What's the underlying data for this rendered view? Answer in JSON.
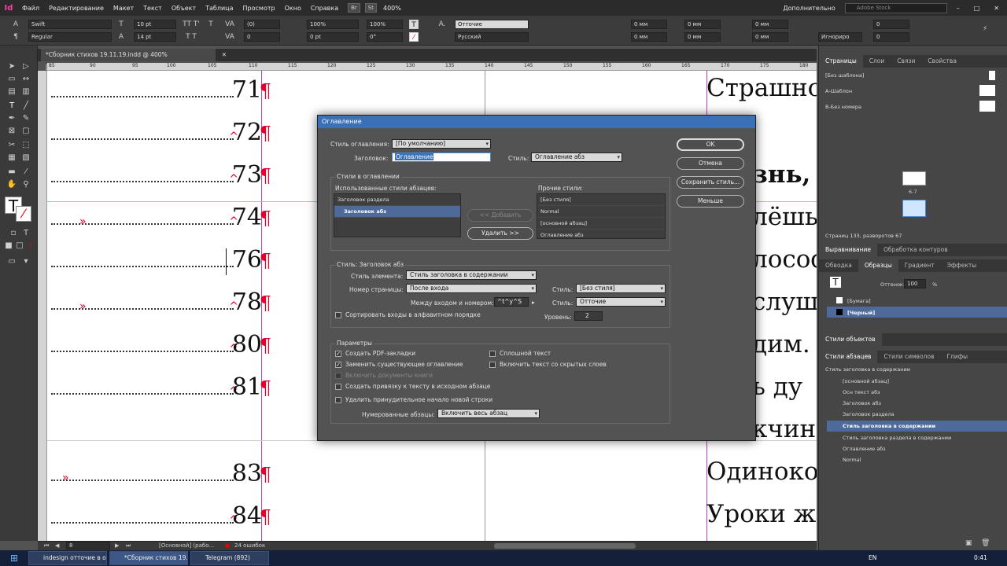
{
  "app": {
    "logo": "Id",
    "menu": [
      "Файл",
      "Редактирование",
      "Макет",
      "Текст",
      "Объект",
      "Таблица",
      "Просмотр",
      "Окно",
      "Справка"
    ],
    "br_badge": "Br",
    "st_badge": "St",
    "zoom": "400%",
    "workspace": "Дополнительно",
    "stock_placeholder": "Adobe Stock"
  },
  "control": {
    "font": "Swift",
    "style": "Regular",
    "size": "10 pt",
    "leading": "14 pt",
    "kerning": "(0)",
    "tracking": "0",
    "scale_v": "100%",
    "scale_h": "100%",
    "baseline": "0 pt",
    "skew": "0°",
    "char_style": "Отточие",
    "language": "Русский",
    "indent_l": "0 мм",
    "indent_r": "0 мм",
    "indent_f": "0 мм",
    "indent_ll": "0 мм",
    "space_b": "0 мм",
    "space_a": "0 мм",
    "cols": "0",
    "cols2": "0",
    "ignore": "Игнориро"
  },
  "document": {
    "tab_title": "*Сборник стихов 19.11.19.indd @ 400% [Преобразован]",
    "ruler_ticks": [
      "85",
      "90",
      "95",
      "100",
      "105",
      "110",
      "115",
      "120",
      "125",
      "130",
      "135",
      "140",
      "145",
      "150",
      "155",
      "160",
      "165",
      "170",
      "175",
      "180"
    ],
    "toc_numbers": [
      "71",
      "72",
      "73",
      "74",
      "76",
      "78",
      "80",
      "81",
      "83",
      "84"
    ],
    "right_text": [
      "Страшно",
      "знь, ",
      "лёшь",
      "лософ",
      "слуш",
      "дим. ",
      "ь ду",
      "кчин",
      "Одиноко",
      "Уроки ж"
    ]
  },
  "status": {
    "page": "8",
    "master": "[Основной] (рабо...",
    "errors": "24 ошибок"
  },
  "panels": {
    "pages_tabs": [
      "Страницы",
      "Слои",
      "Связи",
      "Свойства"
    ],
    "masters": [
      "[Без шаблона]",
      "А-Шаблон",
      "В-Без номера"
    ],
    "spread_label": "6-7",
    "pages_summary": "Страниц 133, разворотов 67",
    "align_tabs": [
      "Выравнивание",
      "Обработка контуров"
    ],
    "swatch_tabs": [
      "Обводка",
      "Образцы",
      "Градиент",
      "Эффекты"
    ],
    "tint_label": "Оттенок:",
    "tint_value": "100",
    "tint_unit": "%",
    "swatches": [
      "[Бумага]",
      "[Черный]"
    ],
    "obj_styles_tab": "Стили объектов",
    "para_tabs": [
      "Стили абзацев",
      "Стили символов",
      "Глифы"
    ],
    "current_style": "Стиль заголовка в содержании",
    "para_styles": [
      "[основной абзац]",
      "Осн текст абз",
      "Заголовок абз",
      "Заголовок раздела",
      "Стиль заголовка в содержании",
      "Стиль заголовка раздела в содержании",
      "Оглавление абз",
      "Normal"
    ]
  },
  "taskbar": {
    "items": [
      "indesign отточие в о...",
      "*Сборник стихов 19....",
      "Telegram (892)"
    ],
    "lang": "EN",
    "time": "0:41"
  },
  "dialog": {
    "title": "Оглавление",
    "toc_style_label": "Стиль оглавления:",
    "toc_style_value": "[По умолчанию]",
    "heading_label": "Заголовок:",
    "heading_value": "Оглавление",
    "style_label": "Стиль:",
    "style_value": "Оглавление абз",
    "styles_group": "Стили в оглавлении",
    "used_label": "Использованные стили абзацев:",
    "used": [
      "Заголовок раздела",
      "Заголовок абз"
    ],
    "add_btn": "<< Добавить",
    "remove_btn": "Удалить >>",
    "other_label": "Прочие стили:",
    "other": [
      "[Без стиля]",
      "Normal",
      "[основной абзац]",
      "Оглавление абз"
    ],
    "style_group": "Стиль: Заголовок абз",
    "entry_style_label": "Стиль элемента:",
    "entry_style_value": "Стиль заголовка в содержании",
    "page_num_label": "Номер страницы:",
    "page_num_value": "После входа",
    "pn_style_label": "Стиль:",
    "pn_style_value": "[Без стиля]",
    "between_label": "Между входом и номером:",
    "between_value": "^t^y^S",
    "between_style_label": "Стиль:",
    "between_style_value": "Отточие",
    "sort_label": "Сортировать входы в алфавитном порядке",
    "level_label": "Уровень:",
    "level_value": "2",
    "params_group": "Параметры",
    "opt_pdf": "Создать PDF-закладки",
    "opt_replace": "Заменить существующее оглавление",
    "opt_book": "Включить документы книги",
    "opt_anchor": "Создать привязку к тексту в исходном абзаце",
    "opt_break": "Удалить принудительное начало новой строки",
    "opt_run": "Сплошной текст",
    "opt_hidden": "Включить текст со скрытых слоев",
    "numbered_label": "Нумерованные абзацы:",
    "numbered_value": "Включить весь абзац",
    "ok": "OK",
    "cancel": "Отмена",
    "save_style": "Сохранить стиль...",
    "fewer": "Меньше"
  }
}
